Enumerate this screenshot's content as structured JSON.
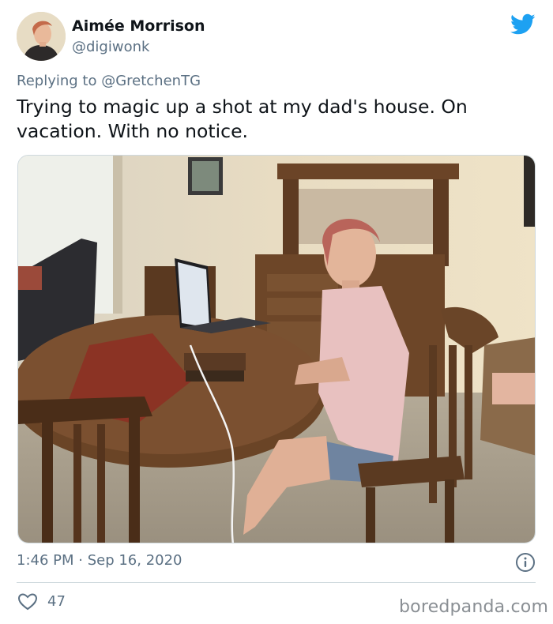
{
  "author": {
    "name": "Aimée Morrison",
    "handle": "@digiwonk"
  },
  "tweet": {
    "reply_prefix": "Replying to ",
    "reply_to": "@GretchenTG",
    "text": "Trying to magic up a shot at my dad's house. On vacation. With no notice.",
    "timestamp": "1:46 PM · Sep 16, 2020",
    "likes": "47"
  },
  "watermark": "boredpanda.com",
  "colors": {
    "twitter_blue": "#1da1f2",
    "secondary_text": "#5b7083"
  },
  "icons": {
    "brand": "twitter-bird-icon",
    "info": "info-icon",
    "like": "heart-icon"
  }
}
